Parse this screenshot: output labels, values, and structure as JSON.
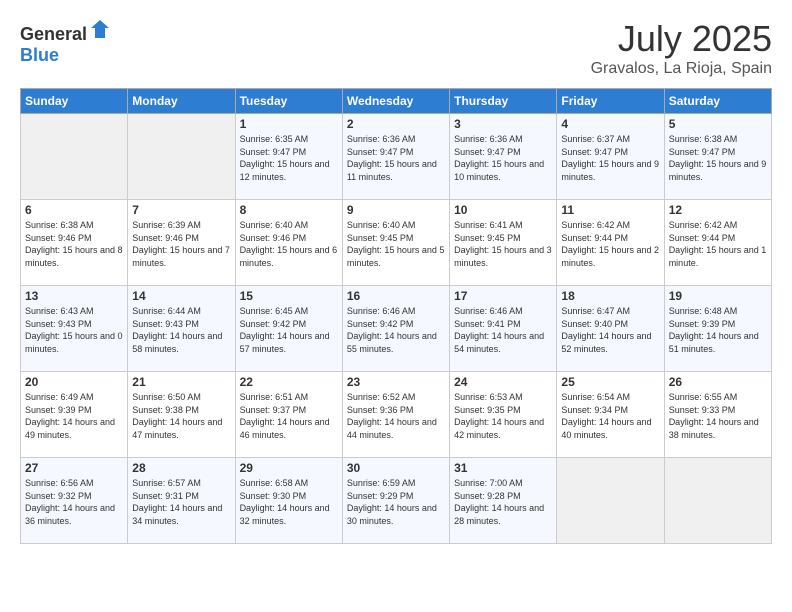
{
  "header": {
    "logo_general": "General",
    "logo_blue": "Blue",
    "month": "July 2025",
    "location": "Gravalos, La Rioja, Spain"
  },
  "weekdays": [
    "Sunday",
    "Monday",
    "Tuesday",
    "Wednesday",
    "Thursday",
    "Friday",
    "Saturday"
  ],
  "weeks": [
    [
      {
        "day": "",
        "sunrise": "",
        "sunset": "",
        "daylight": ""
      },
      {
        "day": "",
        "sunrise": "",
        "sunset": "",
        "daylight": ""
      },
      {
        "day": "1",
        "sunrise": "Sunrise: 6:35 AM",
        "sunset": "Sunset: 9:47 PM",
        "daylight": "Daylight: 15 hours and 12 minutes."
      },
      {
        "day": "2",
        "sunrise": "Sunrise: 6:36 AM",
        "sunset": "Sunset: 9:47 PM",
        "daylight": "Daylight: 15 hours and 11 minutes."
      },
      {
        "day": "3",
        "sunrise": "Sunrise: 6:36 AM",
        "sunset": "Sunset: 9:47 PM",
        "daylight": "Daylight: 15 hours and 10 minutes."
      },
      {
        "day": "4",
        "sunrise": "Sunrise: 6:37 AM",
        "sunset": "Sunset: 9:47 PM",
        "daylight": "Daylight: 15 hours and 9 minutes."
      },
      {
        "day": "5",
        "sunrise": "Sunrise: 6:38 AM",
        "sunset": "Sunset: 9:47 PM",
        "daylight": "Daylight: 15 hours and 9 minutes."
      }
    ],
    [
      {
        "day": "6",
        "sunrise": "Sunrise: 6:38 AM",
        "sunset": "Sunset: 9:46 PM",
        "daylight": "Daylight: 15 hours and 8 minutes."
      },
      {
        "day": "7",
        "sunrise": "Sunrise: 6:39 AM",
        "sunset": "Sunset: 9:46 PM",
        "daylight": "Daylight: 15 hours and 7 minutes."
      },
      {
        "day": "8",
        "sunrise": "Sunrise: 6:40 AM",
        "sunset": "Sunset: 9:46 PM",
        "daylight": "Daylight: 15 hours and 6 minutes."
      },
      {
        "day": "9",
        "sunrise": "Sunrise: 6:40 AM",
        "sunset": "Sunset: 9:45 PM",
        "daylight": "Daylight: 15 hours and 5 minutes."
      },
      {
        "day": "10",
        "sunrise": "Sunrise: 6:41 AM",
        "sunset": "Sunset: 9:45 PM",
        "daylight": "Daylight: 15 hours and 3 minutes."
      },
      {
        "day": "11",
        "sunrise": "Sunrise: 6:42 AM",
        "sunset": "Sunset: 9:44 PM",
        "daylight": "Daylight: 15 hours and 2 minutes."
      },
      {
        "day": "12",
        "sunrise": "Sunrise: 6:42 AM",
        "sunset": "Sunset: 9:44 PM",
        "daylight": "Daylight: 15 hours and 1 minute."
      }
    ],
    [
      {
        "day": "13",
        "sunrise": "Sunrise: 6:43 AM",
        "sunset": "Sunset: 9:43 PM",
        "daylight": "Daylight: 15 hours and 0 minutes."
      },
      {
        "day": "14",
        "sunrise": "Sunrise: 6:44 AM",
        "sunset": "Sunset: 9:43 PM",
        "daylight": "Daylight: 14 hours and 58 minutes."
      },
      {
        "day": "15",
        "sunrise": "Sunrise: 6:45 AM",
        "sunset": "Sunset: 9:42 PM",
        "daylight": "Daylight: 14 hours and 57 minutes."
      },
      {
        "day": "16",
        "sunrise": "Sunrise: 6:46 AM",
        "sunset": "Sunset: 9:42 PM",
        "daylight": "Daylight: 14 hours and 55 minutes."
      },
      {
        "day": "17",
        "sunrise": "Sunrise: 6:46 AM",
        "sunset": "Sunset: 9:41 PM",
        "daylight": "Daylight: 14 hours and 54 minutes."
      },
      {
        "day": "18",
        "sunrise": "Sunrise: 6:47 AM",
        "sunset": "Sunset: 9:40 PM",
        "daylight": "Daylight: 14 hours and 52 minutes."
      },
      {
        "day": "19",
        "sunrise": "Sunrise: 6:48 AM",
        "sunset": "Sunset: 9:39 PM",
        "daylight": "Daylight: 14 hours and 51 minutes."
      }
    ],
    [
      {
        "day": "20",
        "sunrise": "Sunrise: 6:49 AM",
        "sunset": "Sunset: 9:39 PM",
        "daylight": "Daylight: 14 hours and 49 minutes."
      },
      {
        "day": "21",
        "sunrise": "Sunrise: 6:50 AM",
        "sunset": "Sunset: 9:38 PM",
        "daylight": "Daylight: 14 hours and 47 minutes."
      },
      {
        "day": "22",
        "sunrise": "Sunrise: 6:51 AM",
        "sunset": "Sunset: 9:37 PM",
        "daylight": "Daylight: 14 hours and 46 minutes."
      },
      {
        "day": "23",
        "sunrise": "Sunrise: 6:52 AM",
        "sunset": "Sunset: 9:36 PM",
        "daylight": "Daylight: 14 hours and 44 minutes."
      },
      {
        "day": "24",
        "sunrise": "Sunrise: 6:53 AM",
        "sunset": "Sunset: 9:35 PM",
        "daylight": "Daylight: 14 hours and 42 minutes."
      },
      {
        "day": "25",
        "sunrise": "Sunrise: 6:54 AM",
        "sunset": "Sunset: 9:34 PM",
        "daylight": "Daylight: 14 hours and 40 minutes."
      },
      {
        "day": "26",
        "sunrise": "Sunrise: 6:55 AM",
        "sunset": "Sunset: 9:33 PM",
        "daylight": "Daylight: 14 hours and 38 minutes."
      }
    ],
    [
      {
        "day": "27",
        "sunrise": "Sunrise: 6:56 AM",
        "sunset": "Sunset: 9:32 PM",
        "daylight": "Daylight: 14 hours and 36 minutes."
      },
      {
        "day": "28",
        "sunrise": "Sunrise: 6:57 AM",
        "sunset": "Sunset: 9:31 PM",
        "daylight": "Daylight: 14 hours and 34 minutes."
      },
      {
        "day": "29",
        "sunrise": "Sunrise: 6:58 AM",
        "sunset": "Sunset: 9:30 PM",
        "daylight": "Daylight: 14 hours and 32 minutes."
      },
      {
        "day": "30",
        "sunrise": "Sunrise: 6:59 AM",
        "sunset": "Sunset: 9:29 PM",
        "daylight": "Daylight: 14 hours and 30 minutes."
      },
      {
        "day": "31",
        "sunrise": "Sunrise: 7:00 AM",
        "sunset": "Sunset: 9:28 PM",
        "daylight": "Daylight: 14 hours and 28 minutes."
      },
      {
        "day": "",
        "sunrise": "",
        "sunset": "",
        "daylight": ""
      },
      {
        "day": "",
        "sunrise": "",
        "sunset": "",
        "daylight": ""
      }
    ]
  ]
}
